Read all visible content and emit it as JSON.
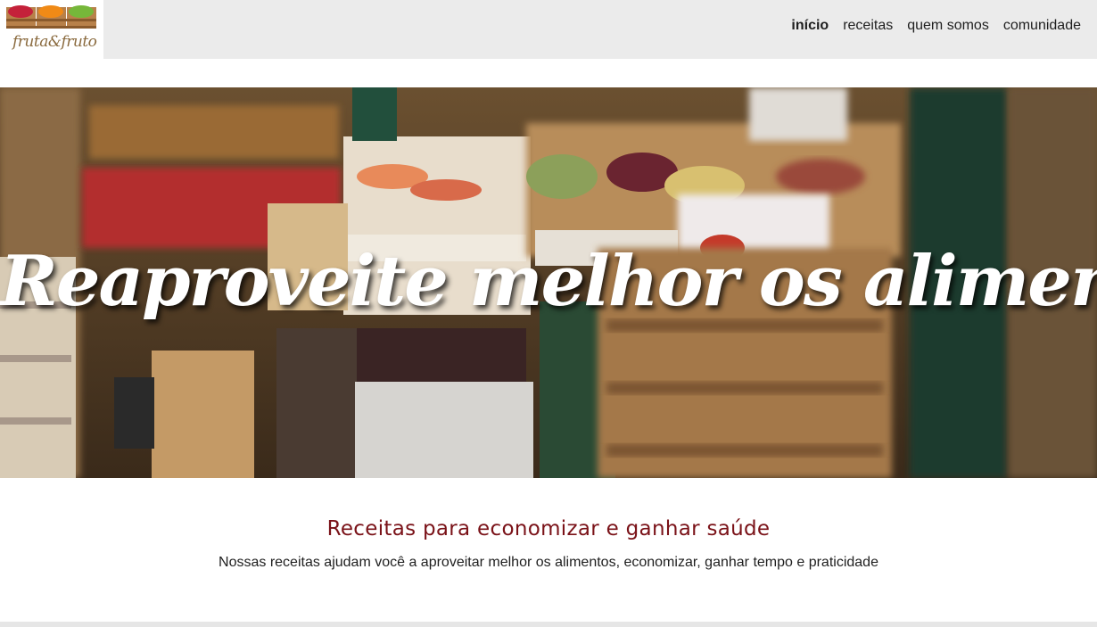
{
  "header": {
    "logo_text": "fruta&fruto",
    "logo_icon": "fruit-crates-logo",
    "nav": [
      {
        "label": "início",
        "active": true
      },
      {
        "label": "receitas",
        "active": false
      },
      {
        "label": "quem somos",
        "active": false
      },
      {
        "label": "comunidade",
        "active": false
      }
    ]
  },
  "hero": {
    "title": "Reaproveite melhor os alimentos!",
    "image": "market-crates-photo"
  },
  "intro": {
    "title": "Receitas para economizar e ganhar saúde",
    "text": "Nossas receitas ajudam você a aproveitar melhor os alimentos, economizar, ganhar tempo e praticidade"
  },
  "colors": {
    "header_bg": "#ebebeb",
    "intro_title": "#7a1218",
    "logo_text": "#8a6a3e"
  }
}
